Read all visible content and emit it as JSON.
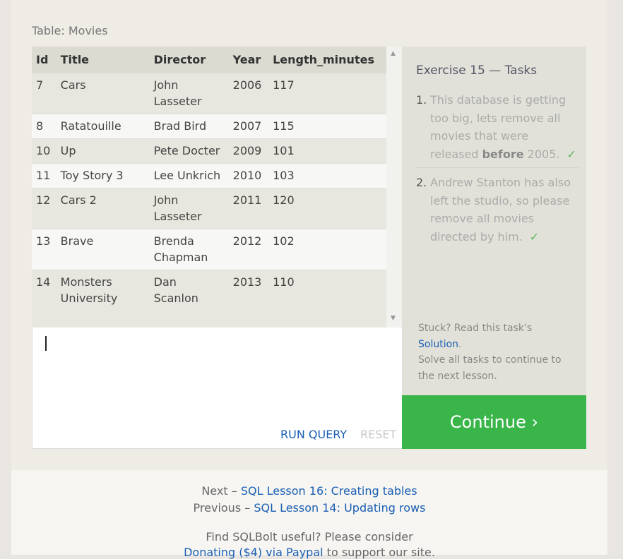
{
  "table_caption": "Table: Movies",
  "table": {
    "columns": [
      "Id",
      "Title",
      "Director",
      "Year",
      "Length_minutes"
    ],
    "rows": [
      [
        "7",
        "Cars",
        "John Lasseter",
        "2006",
        "117"
      ],
      [
        "8",
        "Ratatouille",
        "Brad Bird",
        "2007",
        "115"
      ],
      [
        "10",
        "Up",
        "Pete Docter",
        "2009",
        "101"
      ],
      [
        "11",
        "Toy Story 3",
        "Lee Unkrich",
        "2010",
        "103"
      ],
      [
        "12",
        "Cars 2",
        "John Lasseter",
        "2011",
        "120"
      ],
      [
        "13",
        "Brave",
        "Brenda Chapman",
        "2012",
        "102"
      ],
      [
        "14",
        "Monsters University",
        "Dan Scanlon",
        "2013",
        "110"
      ]
    ]
  },
  "editor": {
    "run_label": "RUN QUERY",
    "reset_label": "RESET"
  },
  "exercise": {
    "title": "Exercise 15 — Tasks",
    "tasks": [
      {
        "num": "1.",
        "text_before": "This database is getting too big, lets remove all movies that were released ",
        "bold": "before",
        "text_after": " 2005.",
        "check": "✓"
      },
      {
        "num": "2.",
        "text": "Andrew Stanton has also left the studio, so please remove all movies directed by him.",
        "check": "✓"
      }
    ],
    "stuck_text": "Stuck? Read this task's",
    "solution_link": "Solution",
    "solution_period": ".",
    "solve_text": "Solve all tasks to continue to the next lesson.",
    "continue_label": "Continue ›"
  },
  "footer": {
    "next_prefix": "Next – ",
    "next_link": "SQL Lesson 16: Creating tables",
    "prev_prefix": "Previous – ",
    "prev_link": "SQL Lesson 14: Updating rows",
    "useful_text": "Find SQLBolt useful? Please consider",
    "donate_link": "Donating ($4) via Paypal",
    "donate_suffix": " to support our site."
  },
  "colors": {
    "accent_green": "#39b54a",
    "link_blue": "#1a5fb4",
    "check_green": "#5cb85c"
  }
}
